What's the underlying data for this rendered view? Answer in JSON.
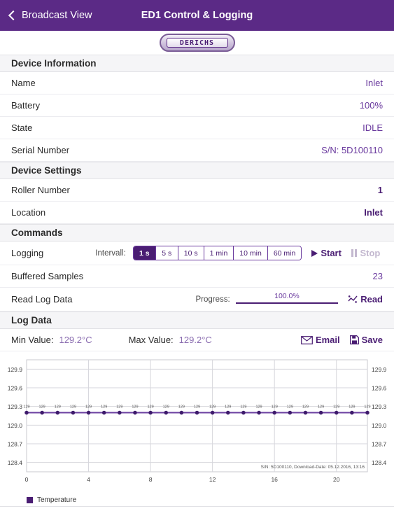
{
  "navbar": {
    "back_label": "Broadcast View",
    "title": "ED1 Control & Logging",
    "back_icon": "chevron-left-icon",
    "bg_color": "#5b2a86"
  },
  "logo": {
    "text": "DERICHS"
  },
  "sections": {
    "device_information": {
      "header": "Device Information",
      "rows": [
        {
          "label": "Name",
          "value": "Inlet"
        },
        {
          "label": "Battery",
          "value": "100%"
        },
        {
          "label": "State",
          "value": "IDLE"
        },
        {
          "label": "Serial Number",
          "value": "S/N: 5D100110"
        }
      ]
    },
    "device_settings": {
      "header": "Device Settings",
      "rows": [
        {
          "label": "Roller Number",
          "value": "1"
        },
        {
          "label": "Location",
          "value": "Inlet"
        }
      ]
    },
    "commands": {
      "header": "Commands",
      "logging": {
        "label": "Logging",
        "interval_label": "Intervall:",
        "options": [
          "1 s",
          "5 s",
          "10 s",
          "1 min",
          "10 min",
          "60 min"
        ],
        "selected": "1 s",
        "start_label": "Start",
        "stop_label": "Stop",
        "start_icon": "play-icon",
        "stop_icon": "pause-icon",
        "stop_disabled": true
      },
      "buffered": {
        "label": "Buffered Samples",
        "value": "23"
      },
      "read_log": {
        "label": "Read Log Data",
        "progress_label": "Progress:",
        "progress_text": "100.0%",
        "progress_percent": 100,
        "read_label": "Read",
        "read_icon": "chart-line-icon"
      }
    },
    "log_data": {
      "header": "Log Data",
      "min_label": "Min Value:",
      "min_value": "129.2°C",
      "max_label": "Max Value:",
      "max_value": "129.2°C",
      "email_label": "Email",
      "email_icon": "envelope-icon",
      "save_label": "Save",
      "save_icon": "floppy-disk-icon"
    }
  },
  "chart_data": {
    "type": "line",
    "title": "",
    "xlabel": "",
    "ylabel": "",
    "series": [
      {
        "name": "Temperature",
        "color": "#6b3fa0",
        "values": [
          129.2,
          129.2,
          129.2,
          129.2,
          129.2,
          129.2,
          129.2,
          129.2,
          129.2,
          129.2,
          129.2,
          129.2,
          129.2,
          129.2,
          129.2,
          129.2,
          129.2,
          129.2,
          129.2,
          129.2,
          129.2,
          129.2,
          129.2
        ],
        "point_labels": [
          "129",
          "129",
          "129",
          "129",
          "129",
          "129",
          "129",
          "129",
          "129",
          "129",
          "129",
          "129",
          "129",
          "129",
          "129",
          "129",
          "129",
          "129",
          "129",
          "129",
          "129",
          "129",
          "129"
        ]
      }
    ],
    "x": [
      0,
      1,
      2,
      3,
      4,
      5,
      6,
      7,
      8,
      9,
      10,
      11,
      12,
      13,
      14,
      15,
      16,
      17,
      18,
      19,
      20,
      21,
      22
    ],
    "xlim": [
      0,
      22
    ],
    "xticks": [
      "0",
      "4",
      "8",
      "12",
      "16",
      "20"
    ],
    "xtick_values": [
      0,
      4,
      8,
      12,
      16,
      20
    ],
    "ylim": [
      128.25,
      130.05
    ],
    "yticks": [
      "128.4",
      "128.7",
      "129.0",
      "129.3",
      "129.6",
      "129.9"
    ],
    "ytick_values": [
      128.4,
      128.7,
      129.0,
      129.3,
      129.6,
      129.9
    ],
    "y_axis_both_sides": true,
    "grid": true,
    "legend": [
      "Temperature"
    ],
    "legend_position": "bottom-left",
    "annotation": "S/N: 5D100110, Download-Date: 05.12.2016, 13:16"
  }
}
